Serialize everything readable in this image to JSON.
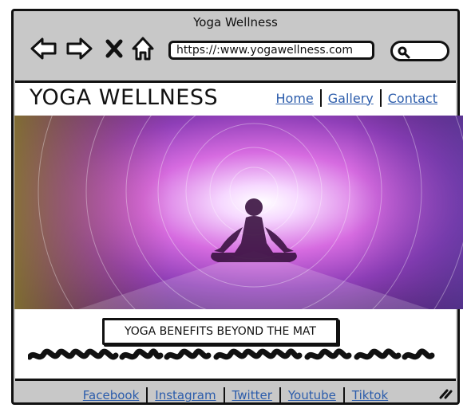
{
  "window": {
    "title": "Yoga Wellness"
  },
  "toolbar": {
    "url": "https://:www.yogawellness.com",
    "icons": [
      "back-arrow-icon",
      "forward-arrow-icon",
      "close-icon",
      "home-icon",
      "search-icon"
    ]
  },
  "site": {
    "title": "YOGA WELLNESS",
    "nav": [
      "Home",
      "Gallery",
      "Contact"
    ]
  },
  "hero": {
    "icon": "meditation-image"
  },
  "content": {
    "heading": "YOGA BENEFITS BEYOND THE MAT"
  },
  "footer": {
    "links": [
      "Facebook",
      "Instagram",
      "Twitter",
      "Youtube",
      "Tiktok"
    ]
  },
  "colors": {
    "link": "#2b5cab",
    "chrome": "#c8c8c8",
    "outline": "#111111"
  }
}
